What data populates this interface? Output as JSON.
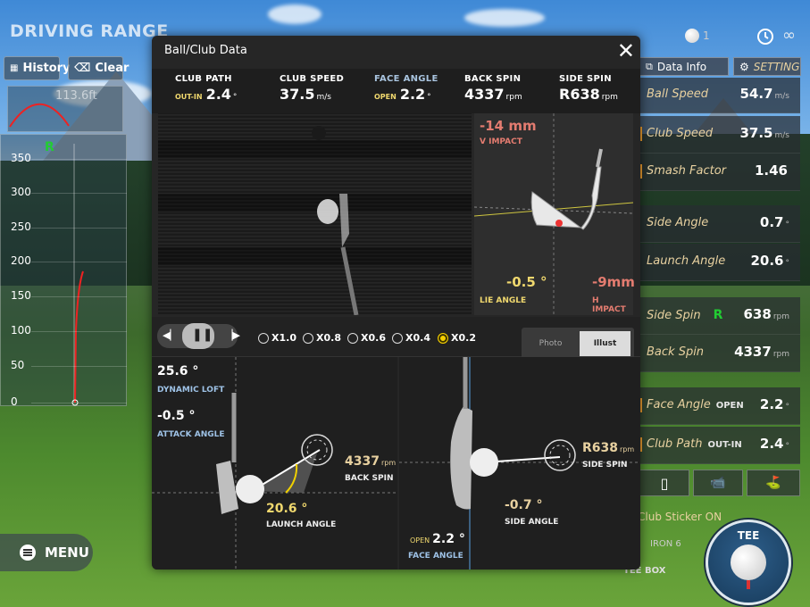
{
  "app": {
    "title": "DRIVING RANGE"
  },
  "toolbar": {
    "history_label": "History",
    "clear_label": "Clear",
    "ball_count": "1"
  },
  "left_chart": {
    "mini_distance": "113.6ft",
    "indicator": "R",
    "ticks": [
      "350",
      "300",
      "250",
      "200",
      "150",
      "100",
      "50",
      "0"
    ]
  },
  "menu": {
    "label": "MENU"
  },
  "modal": {
    "title": "Ball/Club Data",
    "metrics": [
      {
        "label": "CLUB PATH",
        "prefix": "OUT-IN",
        "value": "2.4",
        "unit": "°"
      },
      {
        "label": "CLUB SPEED",
        "prefix": "",
        "value": "37.5",
        "unit": "m/s"
      },
      {
        "label": "FACE ANGLE",
        "prefix": "OPEN",
        "value": "2.2",
        "unit": "°"
      },
      {
        "label": "BACK SPIN",
        "prefix": "",
        "value": "4337",
        "unit": "rpm"
      },
      {
        "label": "SIDE SPIN",
        "prefix": "",
        "value": "R638",
        "unit": "rpm"
      }
    ],
    "impact": {
      "v_value": "-14 mm",
      "v_label": "V IMPACT",
      "lie_value": "-0.5 °",
      "lie_label": "LIE ANGLE",
      "h_value": "-9mm",
      "h_label": "H IMPACT"
    },
    "playback": {
      "speeds": [
        "X1.0",
        "X0.8",
        "X0.6",
        "X0.4",
        "X0.2"
      ],
      "selected": "X0.2",
      "view_photo": "Photo",
      "view_illust": "Illust"
    },
    "side_view": {
      "dynamic_loft_value": "25.6 °",
      "dynamic_loft_label": "DYNAMIC LOFT",
      "attack_value": "-0.5 °",
      "attack_label": "ATTACK ANGLE",
      "backspin_value": "4337",
      "backspin_unit": "rpm",
      "backspin_label": "BACK SPIN",
      "launch_value": "20.6 °",
      "launch_label": "LAUNCH ANGLE"
    },
    "top_view": {
      "sidespin_value": "R638",
      "sidespin_unit": "rpm",
      "sidespin_label": "SIDE SPIN",
      "side_angle_value": "-0.7 °",
      "side_angle_label": "SIDE ANGLE",
      "face_prefix": "OPEN",
      "face_value": "2.2 °",
      "face_label": "FACE ANGLE"
    }
  },
  "right_panel": {
    "data_info_label": "Data Info",
    "setting_label": "SETTING",
    "rows": [
      {
        "label": "Ball Speed",
        "value": "54.7",
        "unit": "m/s"
      },
      {
        "label": "Club Speed",
        "value": "37.5",
        "unit": "m/s"
      },
      {
        "label": "Smash Factor",
        "value": "1.46",
        "unit": ""
      },
      {
        "label": "Side Angle",
        "value": "0.7",
        "unit": "°"
      },
      {
        "label": "Launch Angle",
        "value": "20.6",
        "unit": "°"
      },
      {
        "label": "Side Spin",
        "tag": "R",
        "value": "638",
        "unit": "rpm"
      },
      {
        "label": "Back Spin",
        "value": "4337",
        "unit": "rpm"
      },
      {
        "label": "Face Angle",
        "tag": "OPEN",
        "value": "2.2",
        "unit": "°"
      },
      {
        "label": "Club Path",
        "tag": "OUT-IN",
        "value": "2.4",
        "unit": "°"
      }
    ],
    "club_sticker": "Club Sticker ON",
    "iron": "IRON 6",
    "tee_box": "TEE BOX",
    "tee_label": "TEE"
  }
}
